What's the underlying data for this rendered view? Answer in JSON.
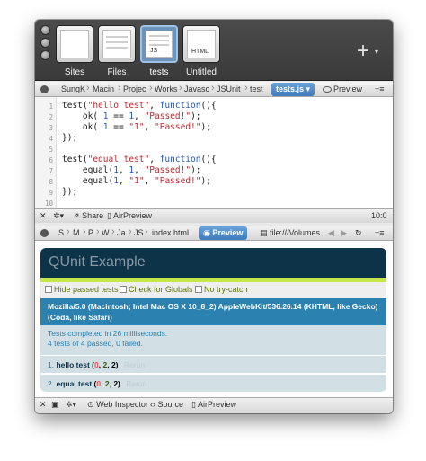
{
  "projects": [
    {
      "label": "Sites",
      "selected": false
    },
    {
      "label": "Files",
      "selected": false
    },
    {
      "label": "tests",
      "selected": true,
      "tag": "JS"
    },
    {
      "label": "Untitled",
      "selected": false,
      "tag": "HTML"
    }
  ],
  "editor_path": {
    "crumbs": [
      "SungK",
      "Macin",
      "Projec",
      "Works",
      "Javasc",
      "JSUnit",
      "test"
    ],
    "active_file": "tests.js",
    "preview_label": "Preview"
  },
  "code": {
    "lines": [
      "1",
      "2",
      "3",
      "4",
      "5",
      "6",
      "7",
      "8",
      "9",
      "10"
    ]
  },
  "editor_status": {
    "share_label": "Share",
    "airpreview_label": "AirPreview",
    "position": "10:0"
  },
  "preview_path": {
    "crumbs": [
      "S",
      "M",
      "P",
      "W",
      "Ja",
      "JS"
    ],
    "active_file": "index.html",
    "preview_label": "Preview",
    "url": "file:///Volumes"
  },
  "qunit": {
    "title": "QUnit Example",
    "options": [
      "Hide passed tests",
      "Check for Globals",
      "No try-catch"
    ],
    "user_agent": "Mozilla/5.0 (Macintosh; Intel Mac OS X 10_8_2) AppleWebKit/536.26.14 (KHTML, like Gecko) (Coda, like Safari)",
    "result_line1": "Tests completed in 26 milliseconds.",
    "result_line2": "4 tests of 4 passed, 0 failed.",
    "tests": [
      {
        "num": "1.",
        "name": "hello test",
        "failed": "0",
        "passed": "2",
        "total": "2",
        "rerun": "Rerun"
      },
      {
        "num": "2.",
        "name": "equal test",
        "failed": "0",
        "passed": "2",
        "total": "2",
        "rerun": "Rerun"
      }
    ]
  },
  "bottom_status": {
    "inspector_label": "Web Inspector",
    "source_label": "Source",
    "airpreview_label": "AirPreview"
  },
  "colors": {
    "qunit_header": "#0d3349",
    "qunit_banner": "#c6e746",
    "qunit_ua": "#2b81af",
    "active_tab": "#3f7cbd"
  }
}
